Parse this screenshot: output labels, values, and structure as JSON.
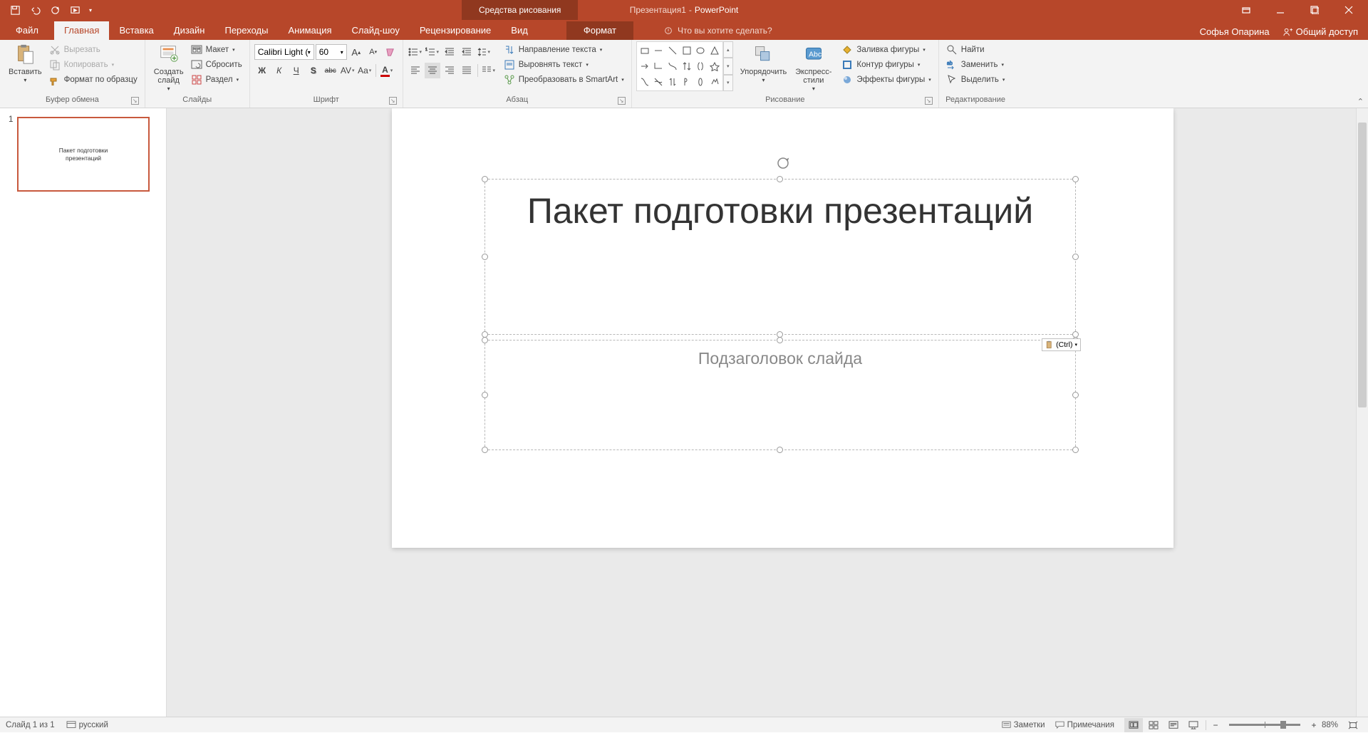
{
  "titlebar": {
    "doc": "Презентация1",
    "app": "PowerPoint",
    "tool_tab": "Средства рисования"
  },
  "tabs": {
    "file": "Файл",
    "home": "Главная",
    "insert": "Вставка",
    "design": "Дизайн",
    "transitions": "Переходы",
    "animations": "Анимация",
    "slideshow": "Слайд-шоу",
    "review": "Рецензирование",
    "view": "Вид",
    "format": "Формат"
  },
  "tellme": "Что вы хотите сделать?",
  "user": "Софья Опарина",
  "share": "Общий доступ",
  "ribbon": {
    "clipboard": {
      "label": "Буфер обмена",
      "paste": "Вставить",
      "cut": "Вырезать",
      "copy": "Копировать",
      "format_painter": "Формат по образцу"
    },
    "slides": {
      "label": "Слайды",
      "new_slide": "Создать\nслайд",
      "layout": "Макет",
      "reset": "Сбросить",
      "section": "Раздел"
    },
    "font": {
      "label": "Шрифт",
      "name": "Calibri Light (З",
      "size": "60",
      "bold": "Ж",
      "italic": "К",
      "underline": "Ч",
      "shadow": "S",
      "strike": "abc",
      "spacing": "AV",
      "case": "Aa"
    },
    "paragraph": {
      "label": "Абзац",
      "direction": "Направление текста",
      "align_text": "Выровнять текст",
      "smartart": "Преобразовать в SmartArt"
    },
    "drawing": {
      "label": "Рисование",
      "arrange": "Упорядочить",
      "quick_styles": "Экспресс-\nстили",
      "fill": "Заливка фигуры",
      "outline": "Контур фигуры",
      "effects": "Эффекты фигуры"
    },
    "editing": {
      "label": "Редактирование",
      "find": "Найти",
      "replace": "Заменить",
      "select": "Выделить"
    }
  },
  "thumb": {
    "num": "1",
    "title": "Пакет подготовки",
    "title2": "презентаций"
  },
  "slide": {
    "title": "Пакет подготовки презентаций",
    "subtitle": "Подзаголовок слайда",
    "paste_ctrl": "(Ctrl)"
  },
  "status": {
    "slide_info": "Слайд 1 из 1",
    "lang": "русский",
    "notes": "Заметки",
    "comments": "Примечания",
    "zoom": "88%"
  }
}
